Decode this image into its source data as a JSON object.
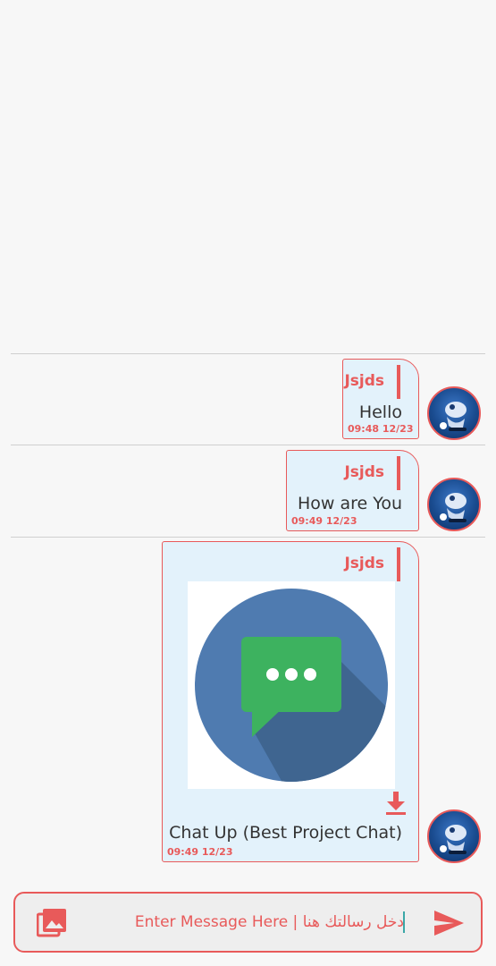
{
  "messages": [
    {
      "sender": "Jsjds",
      "text": "Hello",
      "time": "09:48 12/23"
    },
    {
      "sender": "Jsjds",
      "text": "How are You",
      "time": "09:49 12/23"
    },
    {
      "sender": "Jsjds",
      "text": "Chat Up (Best Project Chat)",
      "time": "09:49 12/23",
      "image": "chat-app-logo",
      "download_icon": "download-icon"
    }
  ],
  "composer": {
    "placeholder": "Enter Message Here | دخل رسالتك هنا",
    "gallery_icon": "photo-library-icon",
    "send_icon": "send-icon"
  },
  "colors": {
    "accent": "#e85a5a",
    "bubble": "#e3f2fb",
    "background": "#f7f7f7"
  }
}
